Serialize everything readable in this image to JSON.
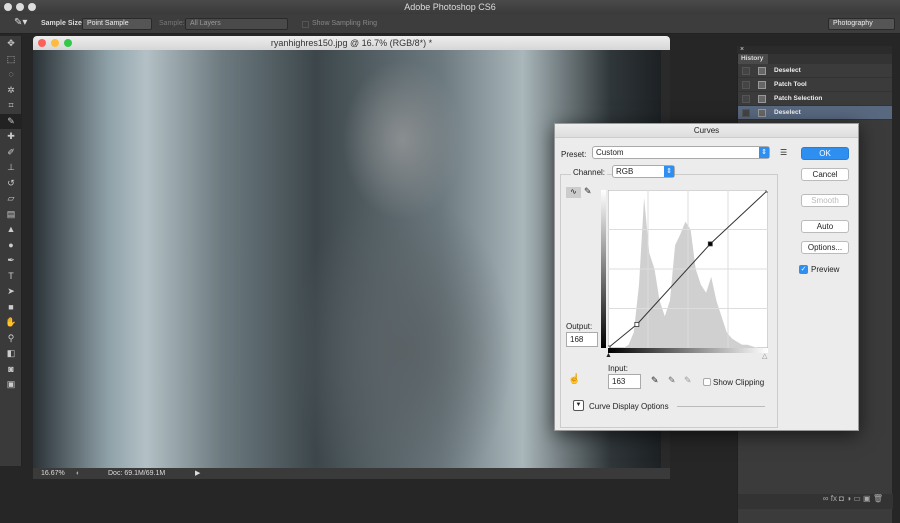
{
  "app": {
    "title": "Adobe Photoshop CS6"
  },
  "options": {
    "sample_size_label": "Sample Size:",
    "sample_size_value": "Point Sample",
    "sample_label": "Sample:",
    "sample_value": "All Layers",
    "show_ring_label": "Show Sampling Ring",
    "workspace": "Photography"
  },
  "document": {
    "title": "ryanhighres150.jpg @ 16.7% (RGB/8*) *",
    "zoom": "16.67%",
    "doc_size": "Doc: 69.1M/69.1M"
  },
  "history": {
    "tab": "History",
    "items": [
      "Deselect",
      "Patch Tool",
      "Patch Selection",
      "Deselect"
    ]
  },
  "curves": {
    "title": "Curves",
    "preset_label": "Preset:",
    "preset_value": "Custom",
    "channel_label": "Channel:",
    "channel_value": "RGB",
    "ok": "OK",
    "cancel": "Cancel",
    "smooth": "Smooth",
    "auto": "Auto",
    "options": "Options...",
    "preview": "Preview",
    "output_label": "Output:",
    "output_value": "168",
    "input_label": "Input:",
    "input_value": "163",
    "show_clipping": "Show Clipping",
    "display_options": "Curve Display Options",
    "points": [
      [
        0,
        0
      ],
      [
        46,
        38
      ],
      [
        163,
        168
      ],
      [
        255,
        255
      ]
    ],
    "accent": "#2f8ff0"
  }
}
